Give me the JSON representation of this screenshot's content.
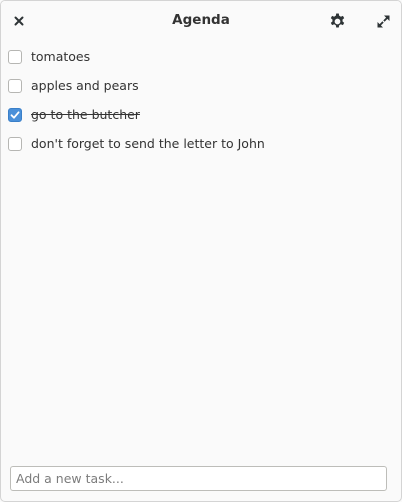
{
  "window": {
    "title": "Agenda"
  },
  "header": {
    "close_icon": "close-icon",
    "settings_icon": "gear-icon",
    "fullscreen_icon": "expand-icon"
  },
  "tasks": [
    {
      "label": "tomatoes",
      "checked": false
    },
    {
      "label": "apples and pears",
      "checked": false
    },
    {
      "label": "go to the butcher",
      "checked": true
    },
    {
      "label": "don't forget to send the letter to John",
      "checked": false
    }
  ],
  "new_task": {
    "placeholder": "Add a new task...",
    "value": ""
  },
  "colors": {
    "accent": "#4a90d9",
    "background": "#fafafa",
    "text": "#333333"
  }
}
